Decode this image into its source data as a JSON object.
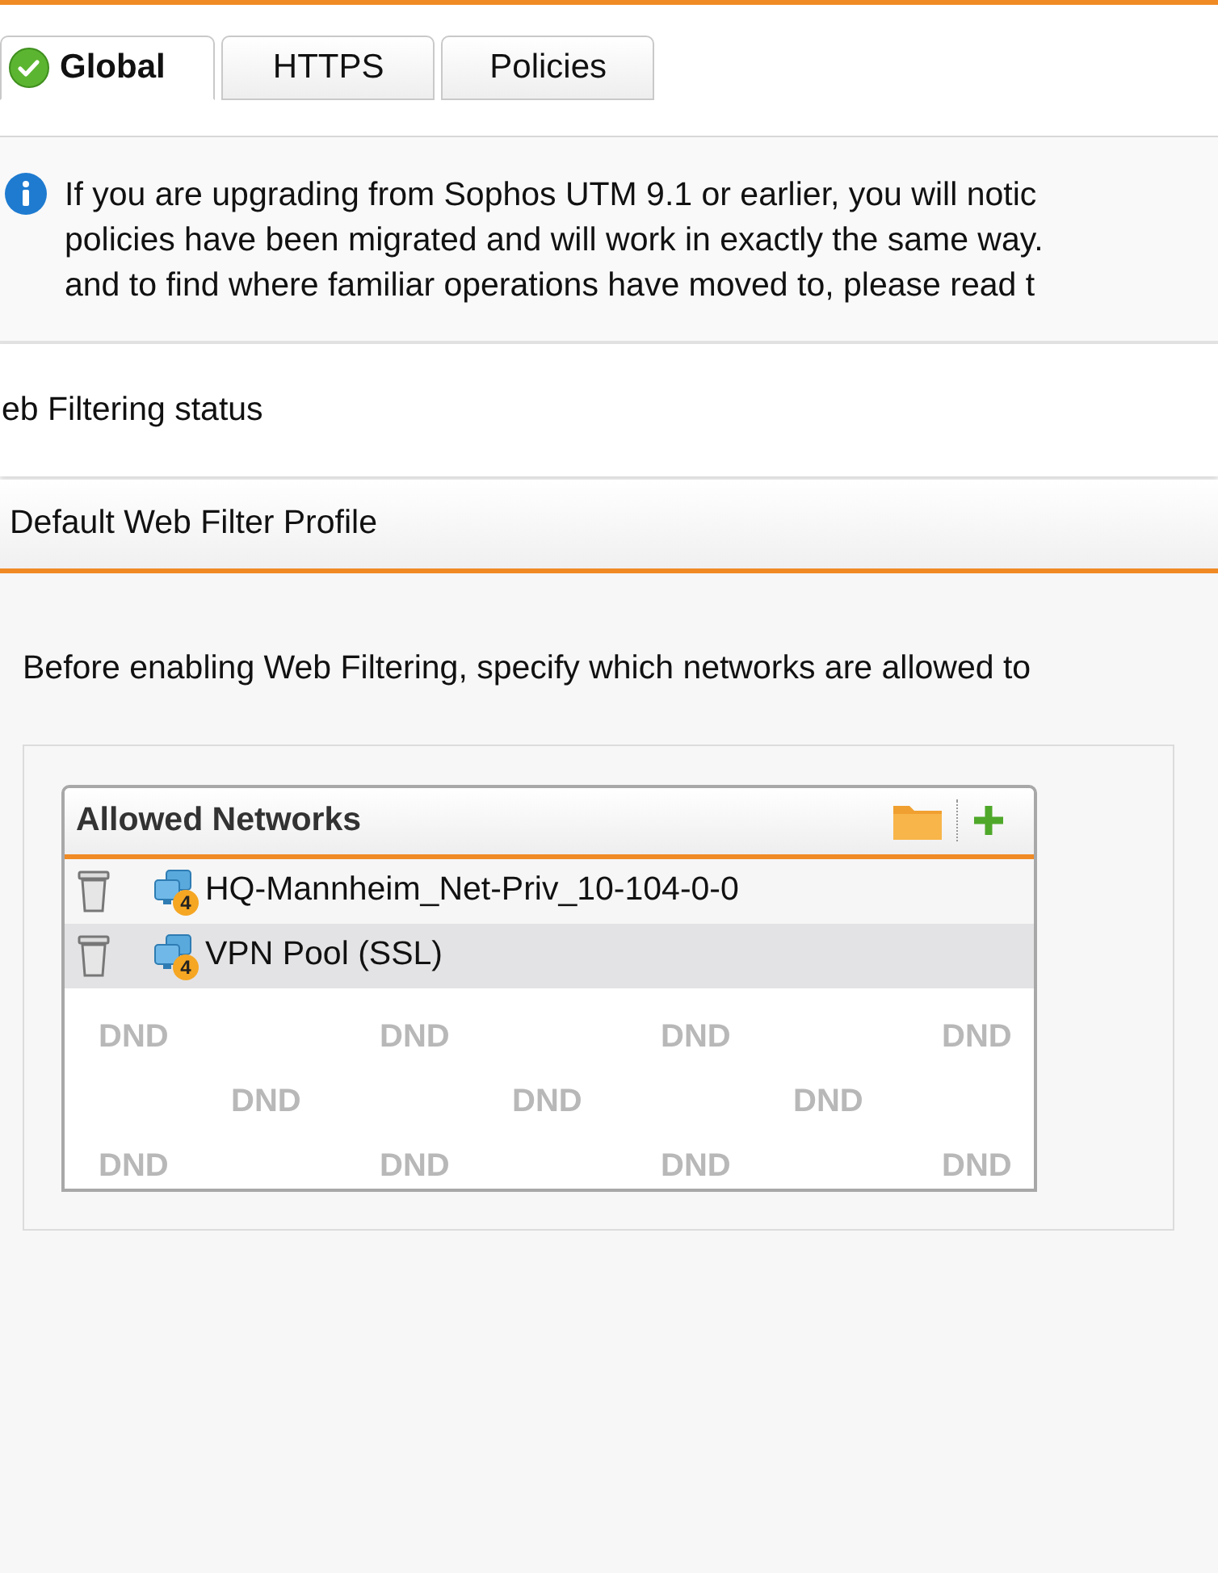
{
  "tabs": [
    {
      "label": "Global",
      "selected": true,
      "status_ok": true
    },
    {
      "label": "HTTPS",
      "selected": false,
      "status_ok": false
    },
    {
      "label": "Policies",
      "selected": false,
      "status_ok": false
    }
  ],
  "info": {
    "lines": [
      "If you are upgrading from Sophos UTM 9.1 or earlier, you will notic",
      "policies have been migrated and will work in exactly the same way.",
      "and to find where familiar operations have moved to, please read t"
    ]
  },
  "status_section": {
    "title": "eb Filtering status"
  },
  "profile_section": {
    "title": "Default Web Filter Profile"
  },
  "intro": "Before enabling Web Filtering, specify which networks are allowed to",
  "allowed_networks": {
    "title": "Allowed Networks",
    "items": [
      {
        "name": "HQ-Mannheim_Net-Priv_10-104-0-0",
        "ip_version": "4",
        "selected": false
      },
      {
        "name": "VPN Pool (SSL)",
        "ip_version": "4",
        "selected": true
      }
    ],
    "drop_marks": [
      [
        "DND",
        "DND",
        "DND",
        "DND"
      ],
      [
        "DND",
        "DND",
        "DND"
      ],
      [
        "DND",
        "DND",
        "DND",
        "DND"
      ]
    ]
  }
}
